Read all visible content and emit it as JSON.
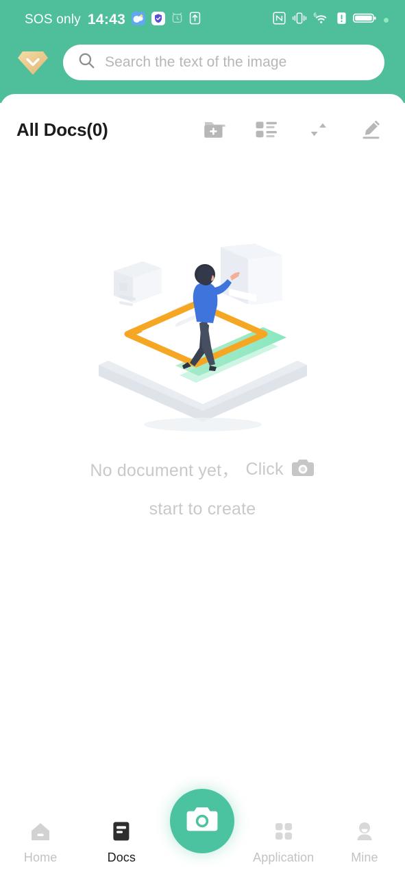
{
  "statusbar": {
    "carrier": "SOS only",
    "time": "14:43",
    "left_icons": [
      "weather-icon",
      "security-shield-icon",
      "alarm-icon",
      "upload-arrow-icon"
    ],
    "right_icons": [
      "nfc-icon",
      "vibrate-icon",
      "wifi-6-icon",
      "alert-icon",
      "battery-icon",
      "status-dot-icon"
    ]
  },
  "header": {
    "brand_icon": "gem-chevron-down-icon",
    "accent_color": "#4fbf9b",
    "gem_color": "#e8c88a"
  },
  "search": {
    "placeholder": "Search the text of the image",
    "icon": "search-icon",
    "value": ""
  },
  "toolbar": {
    "title": "All Docs(0)",
    "actions": [
      {
        "name": "new-folder-button",
        "icon": "folder-plus-icon"
      },
      {
        "name": "list-view-button",
        "icon": "list-view-icon"
      },
      {
        "name": "sort-button",
        "icon": "sort-arrows-icon"
      },
      {
        "name": "edit-button",
        "icon": "pencil-icon"
      }
    ]
  },
  "empty_state": {
    "illustration": "person-scanning-document-isometric-illustration",
    "line1_prefix": "No document yet，",
    "line1_action": "Click",
    "inline_icon": "camera-icon",
    "line2": "start to create",
    "text_color": "#c9c9c9"
  },
  "bottom_nav": {
    "items": [
      {
        "label": "Home",
        "icon": "home-icon",
        "active": false
      },
      {
        "label": "Docs",
        "icon": "docs-icon",
        "active": true
      },
      {
        "label": "Application",
        "icon": "grid-apps-icon",
        "active": false
      },
      {
        "label": "Mine",
        "icon": "person-icon",
        "active": false
      }
    ],
    "fab": {
      "name": "camera-capture-button",
      "icon": "camera-icon",
      "color": "#4cc3a0"
    }
  }
}
